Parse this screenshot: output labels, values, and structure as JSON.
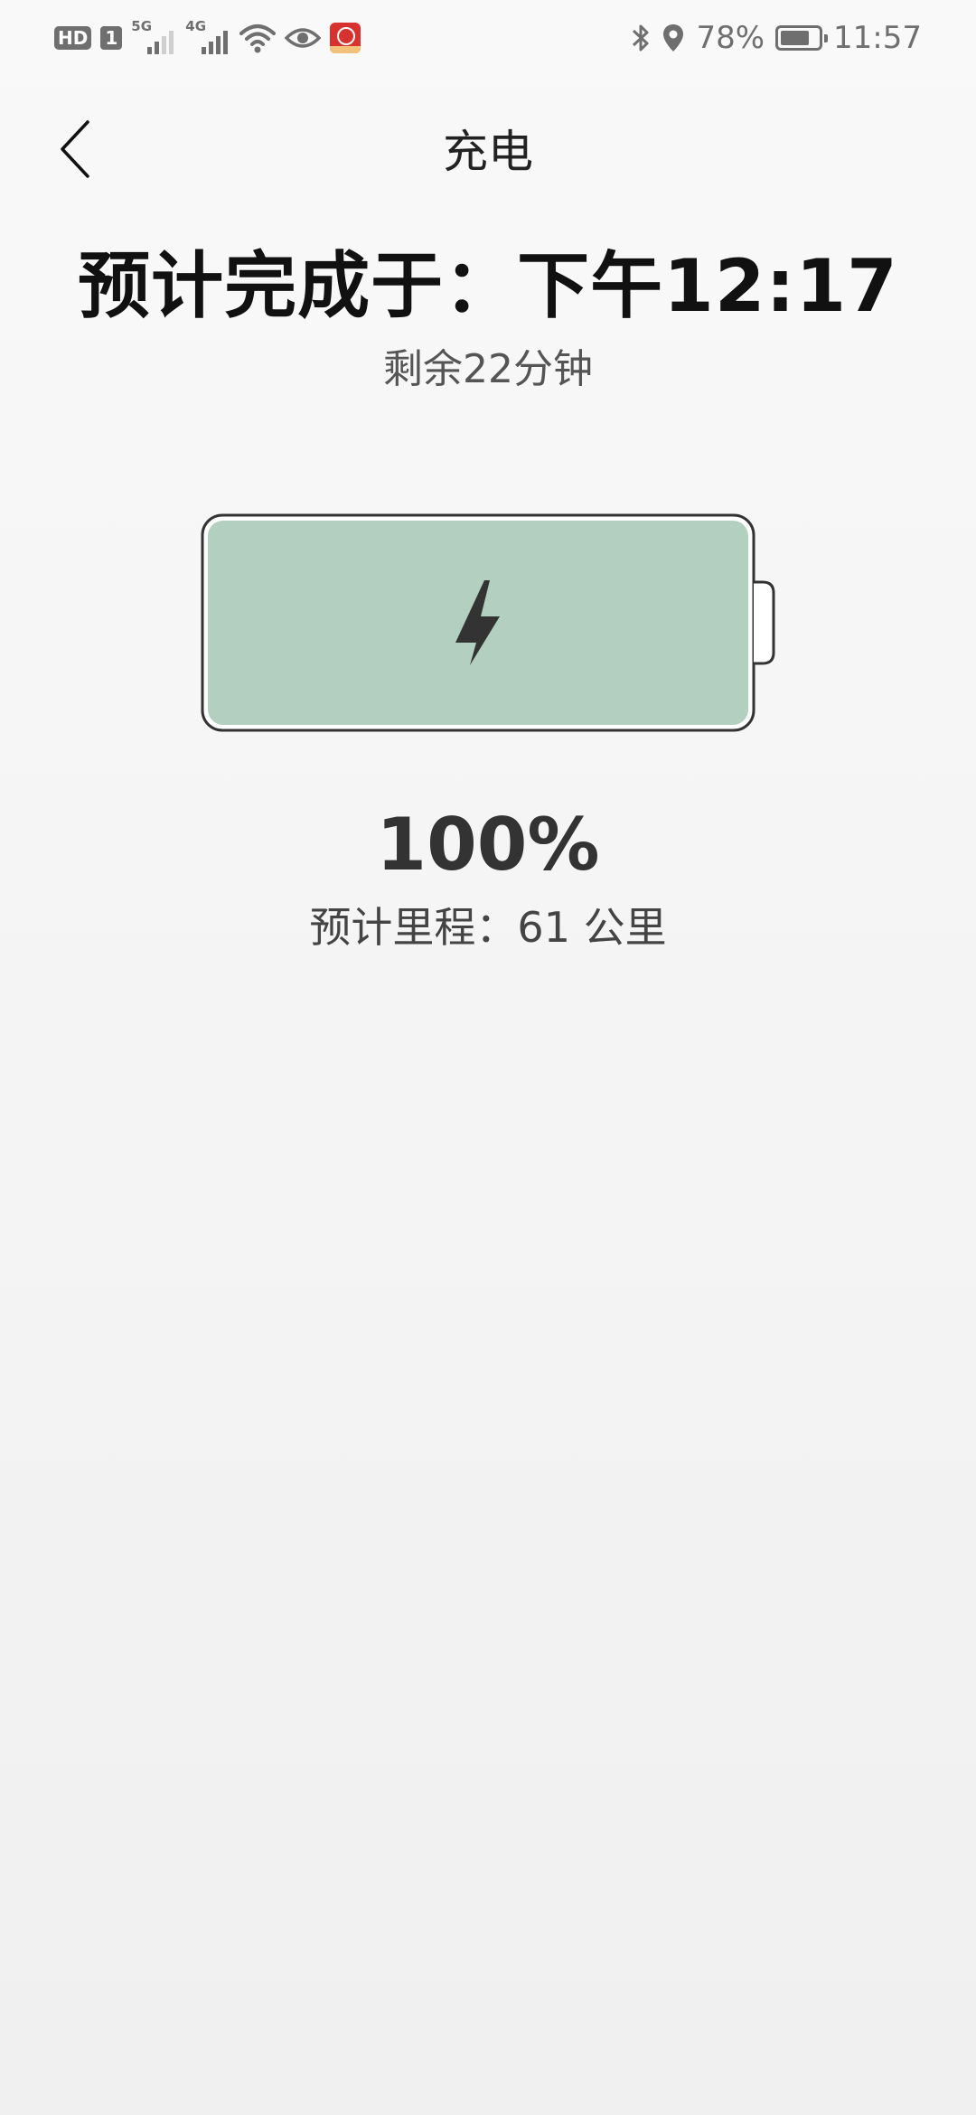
{
  "status_bar": {
    "hd_label": "HD",
    "sim_label": "1",
    "network_1": "5G",
    "network_2": "4G",
    "battery_percent": "78%",
    "battery_level": 0.78,
    "time": "11:57"
  },
  "header": {
    "title": "充电"
  },
  "charging": {
    "eta_label": "预计完成于：下午12:17",
    "remaining_label": "剩余22分钟",
    "charge_level": 1.0,
    "percent_label": "100%",
    "range_label": "预计里程：61 公里"
  },
  "colors": {
    "battery_fill": "#b2cfc0",
    "battery_outline": "#333333",
    "bolt": "#333333"
  }
}
